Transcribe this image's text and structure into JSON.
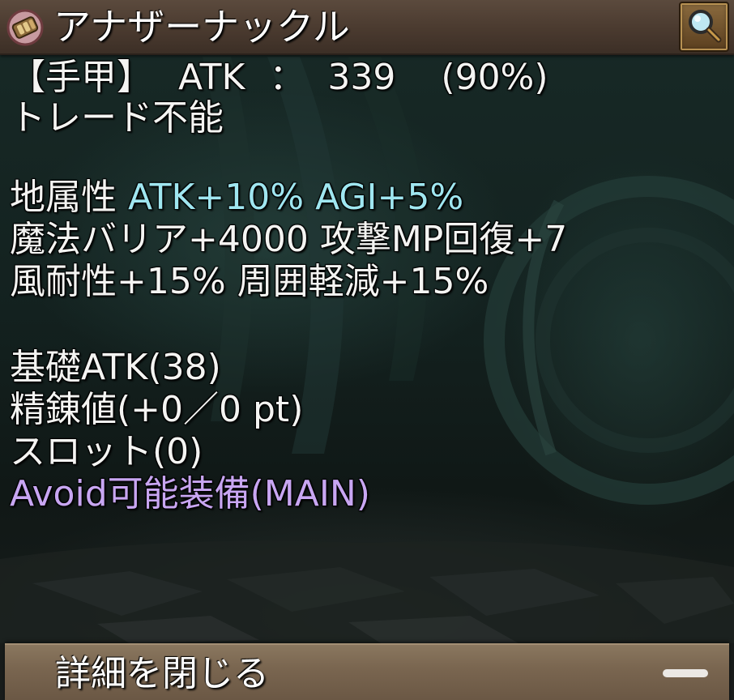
{
  "header": {
    "item_name": "アナザーナックル",
    "item_icon": "fist-gauntlet-icon",
    "search_icon": "magnifier-icon"
  },
  "stats": {
    "weapon_type": "【手甲】",
    "atk_label": "ATK",
    "atk_separator": "：",
    "atk_value": "339",
    "atk_percent": "(90%)",
    "trade": "トレード不能"
  },
  "abilities": {
    "line1_label": "地属性",
    "line1_value": "ATK+10% AGI+5%",
    "line2": "魔法バリア+4000 攻撃MP回復+7",
    "line3": "風耐性+15% 周囲軽減+15%"
  },
  "details": {
    "base_atk": "基礎ATK(38)",
    "refine": "精錬値(+0／0 pt)",
    "slot": "スロット(0)",
    "avoid": "Avoid可能装備(MAIN)"
  },
  "footer": {
    "close_label": "詳細を閉じる"
  },
  "colors": {
    "element_text": "#9fe6f0",
    "avoid_text": "#c8a6f2",
    "title_bar": "#4a3a2f",
    "footer_bar": "#7a6650"
  }
}
